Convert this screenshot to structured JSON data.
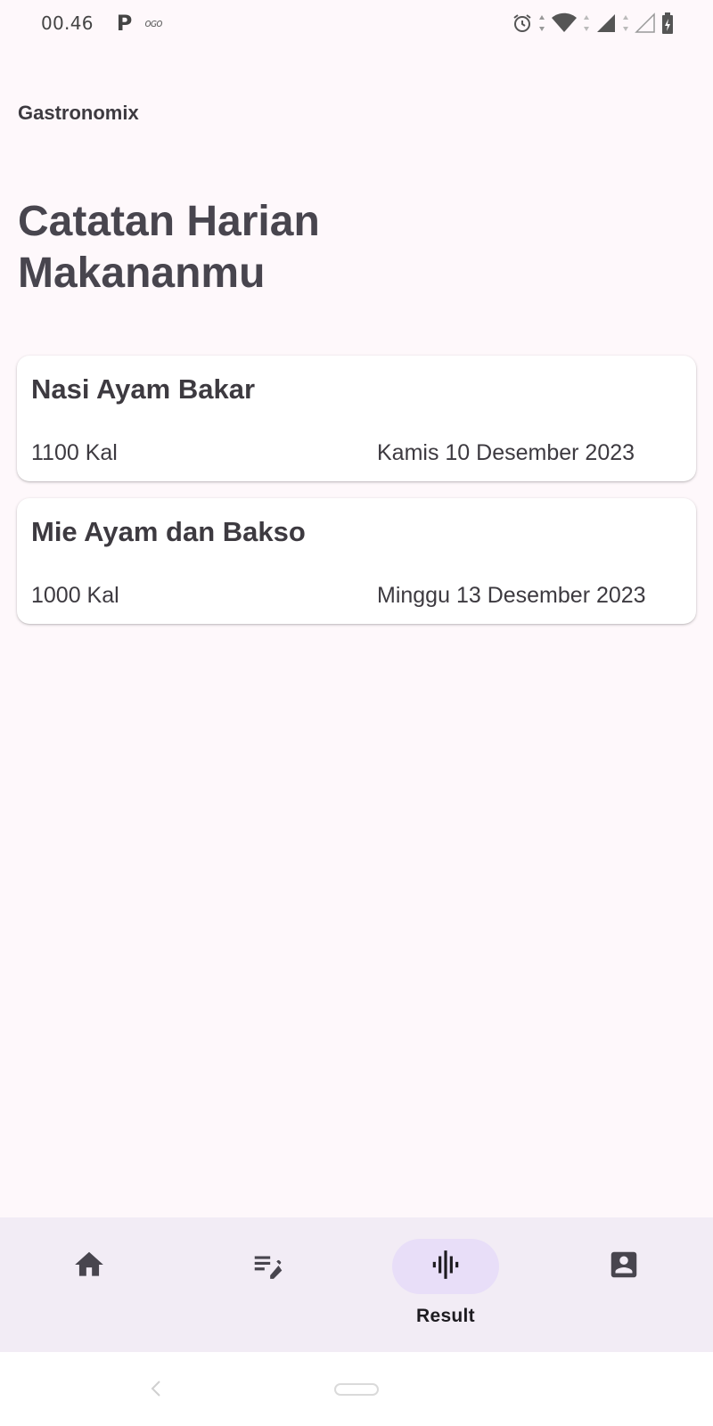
{
  "status_bar": {
    "time": "00.46",
    "app_badge": "P",
    "misc_icons": "ᴏɢᴏ"
  },
  "app": {
    "name": "Gastronomix"
  },
  "page": {
    "title": "Catatan Harian Makananmu"
  },
  "entries": [
    {
      "name": "Nasi Ayam Bakar",
      "calories": "1100 Kal",
      "date": "Kamis 10 Desember 2023"
    },
    {
      "name": "Mie Ayam dan Bakso",
      "calories": "1000 Kal",
      "date": "Minggu 13 Desember 2023"
    }
  ],
  "bottom_nav": {
    "items": [
      {
        "icon": "home-icon",
        "label": ""
      },
      {
        "icon": "edit-note-icon",
        "label": ""
      },
      {
        "icon": "audio-wave-icon",
        "label": "Result"
      },
      {
        "icon": "account-box-icon",
        "label": ""
      }
    ],
    "active_index": 2
  },
  "colors": {
    "background": "#fef8fb",
    "card": "#ffffff",
    "nav_bar": "#f2ecf5",
    "active_indicator": "#e8def8",
    "text": "#3d3a40"
  }
}
